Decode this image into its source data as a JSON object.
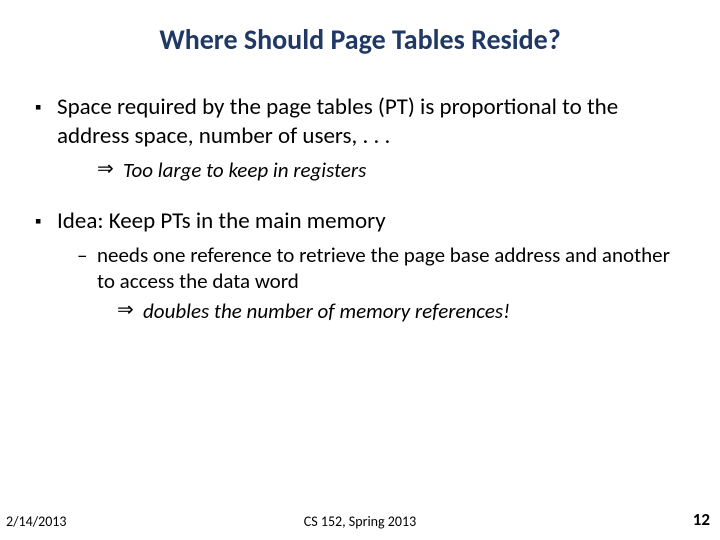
{
  "title": "Where Should Page Tables Reside?",
  "bullets": [
    {
      "text": "Space required by the page tables (PT) is proportional to the address space, number of users, . . .",
      "sub": {
        "text": "Too large to keep in registers"
      }
    },
    {
      "text": "Idea: Keep PTs in the main memory",
      "dash": {
        "text": "needs one reference to retrieve the page base address and another to access the data word",
        "sub": {
          "text": "doubles the number of memory references!"
        }
      }
    }
  ],
  "footer": {
    "date": "2/14/2013",
    "course": "CS 152, Spring 2013",
    "page": "12"
  }
}
